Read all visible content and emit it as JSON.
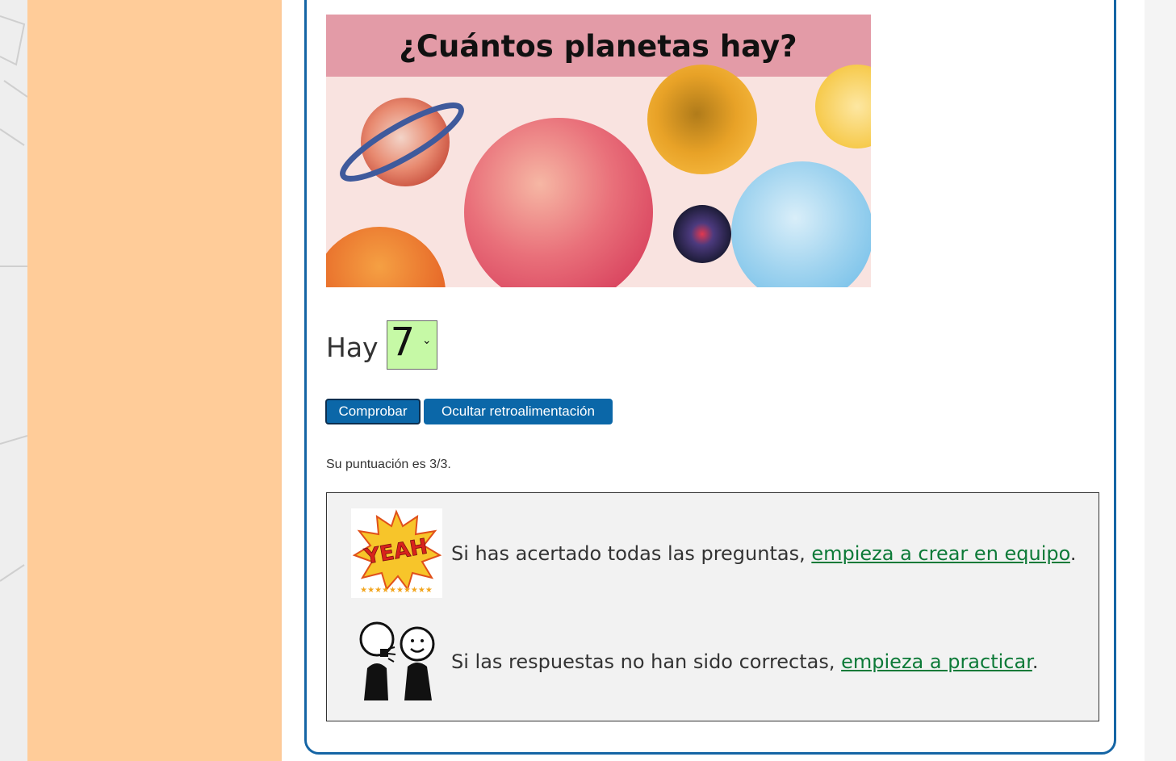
{
  "banner": {
    "title": "¿Cuántos planetas hay?"
  },
  "question": {
    "prefix": "Hay",
    "selected_value": "7"
  },
  "buttons": {
    "check_label": "Comprobar",
    "hide_feedback_label": "Ocultar retroalimentación"
  },
  "score_text": "Su puntuación es 3/3.",
  "feedback": {
    "row1": {
      "text_before": "Si has acertado todas las preguntas, ",
      "link_text": "empieza a crear en equipo",
      "text_after": ".",
      "image_word": "YEAH"
    },
    "row2": {
      "text_before": "Si las respuestas no han sido correctas, ",
      "link_text": "empieza a practicar",
      "text_after": "."
    }
  },
  "colors": {
    "sidebar": "#ffcc99",
    "card_border": "#1565a5",
    "button": "#0b67a8",
    "select_bg": "#c6f9a6",
    "link": "#0d7a38",
    "feedback_bg": "#f2f2f2"
  }
}
